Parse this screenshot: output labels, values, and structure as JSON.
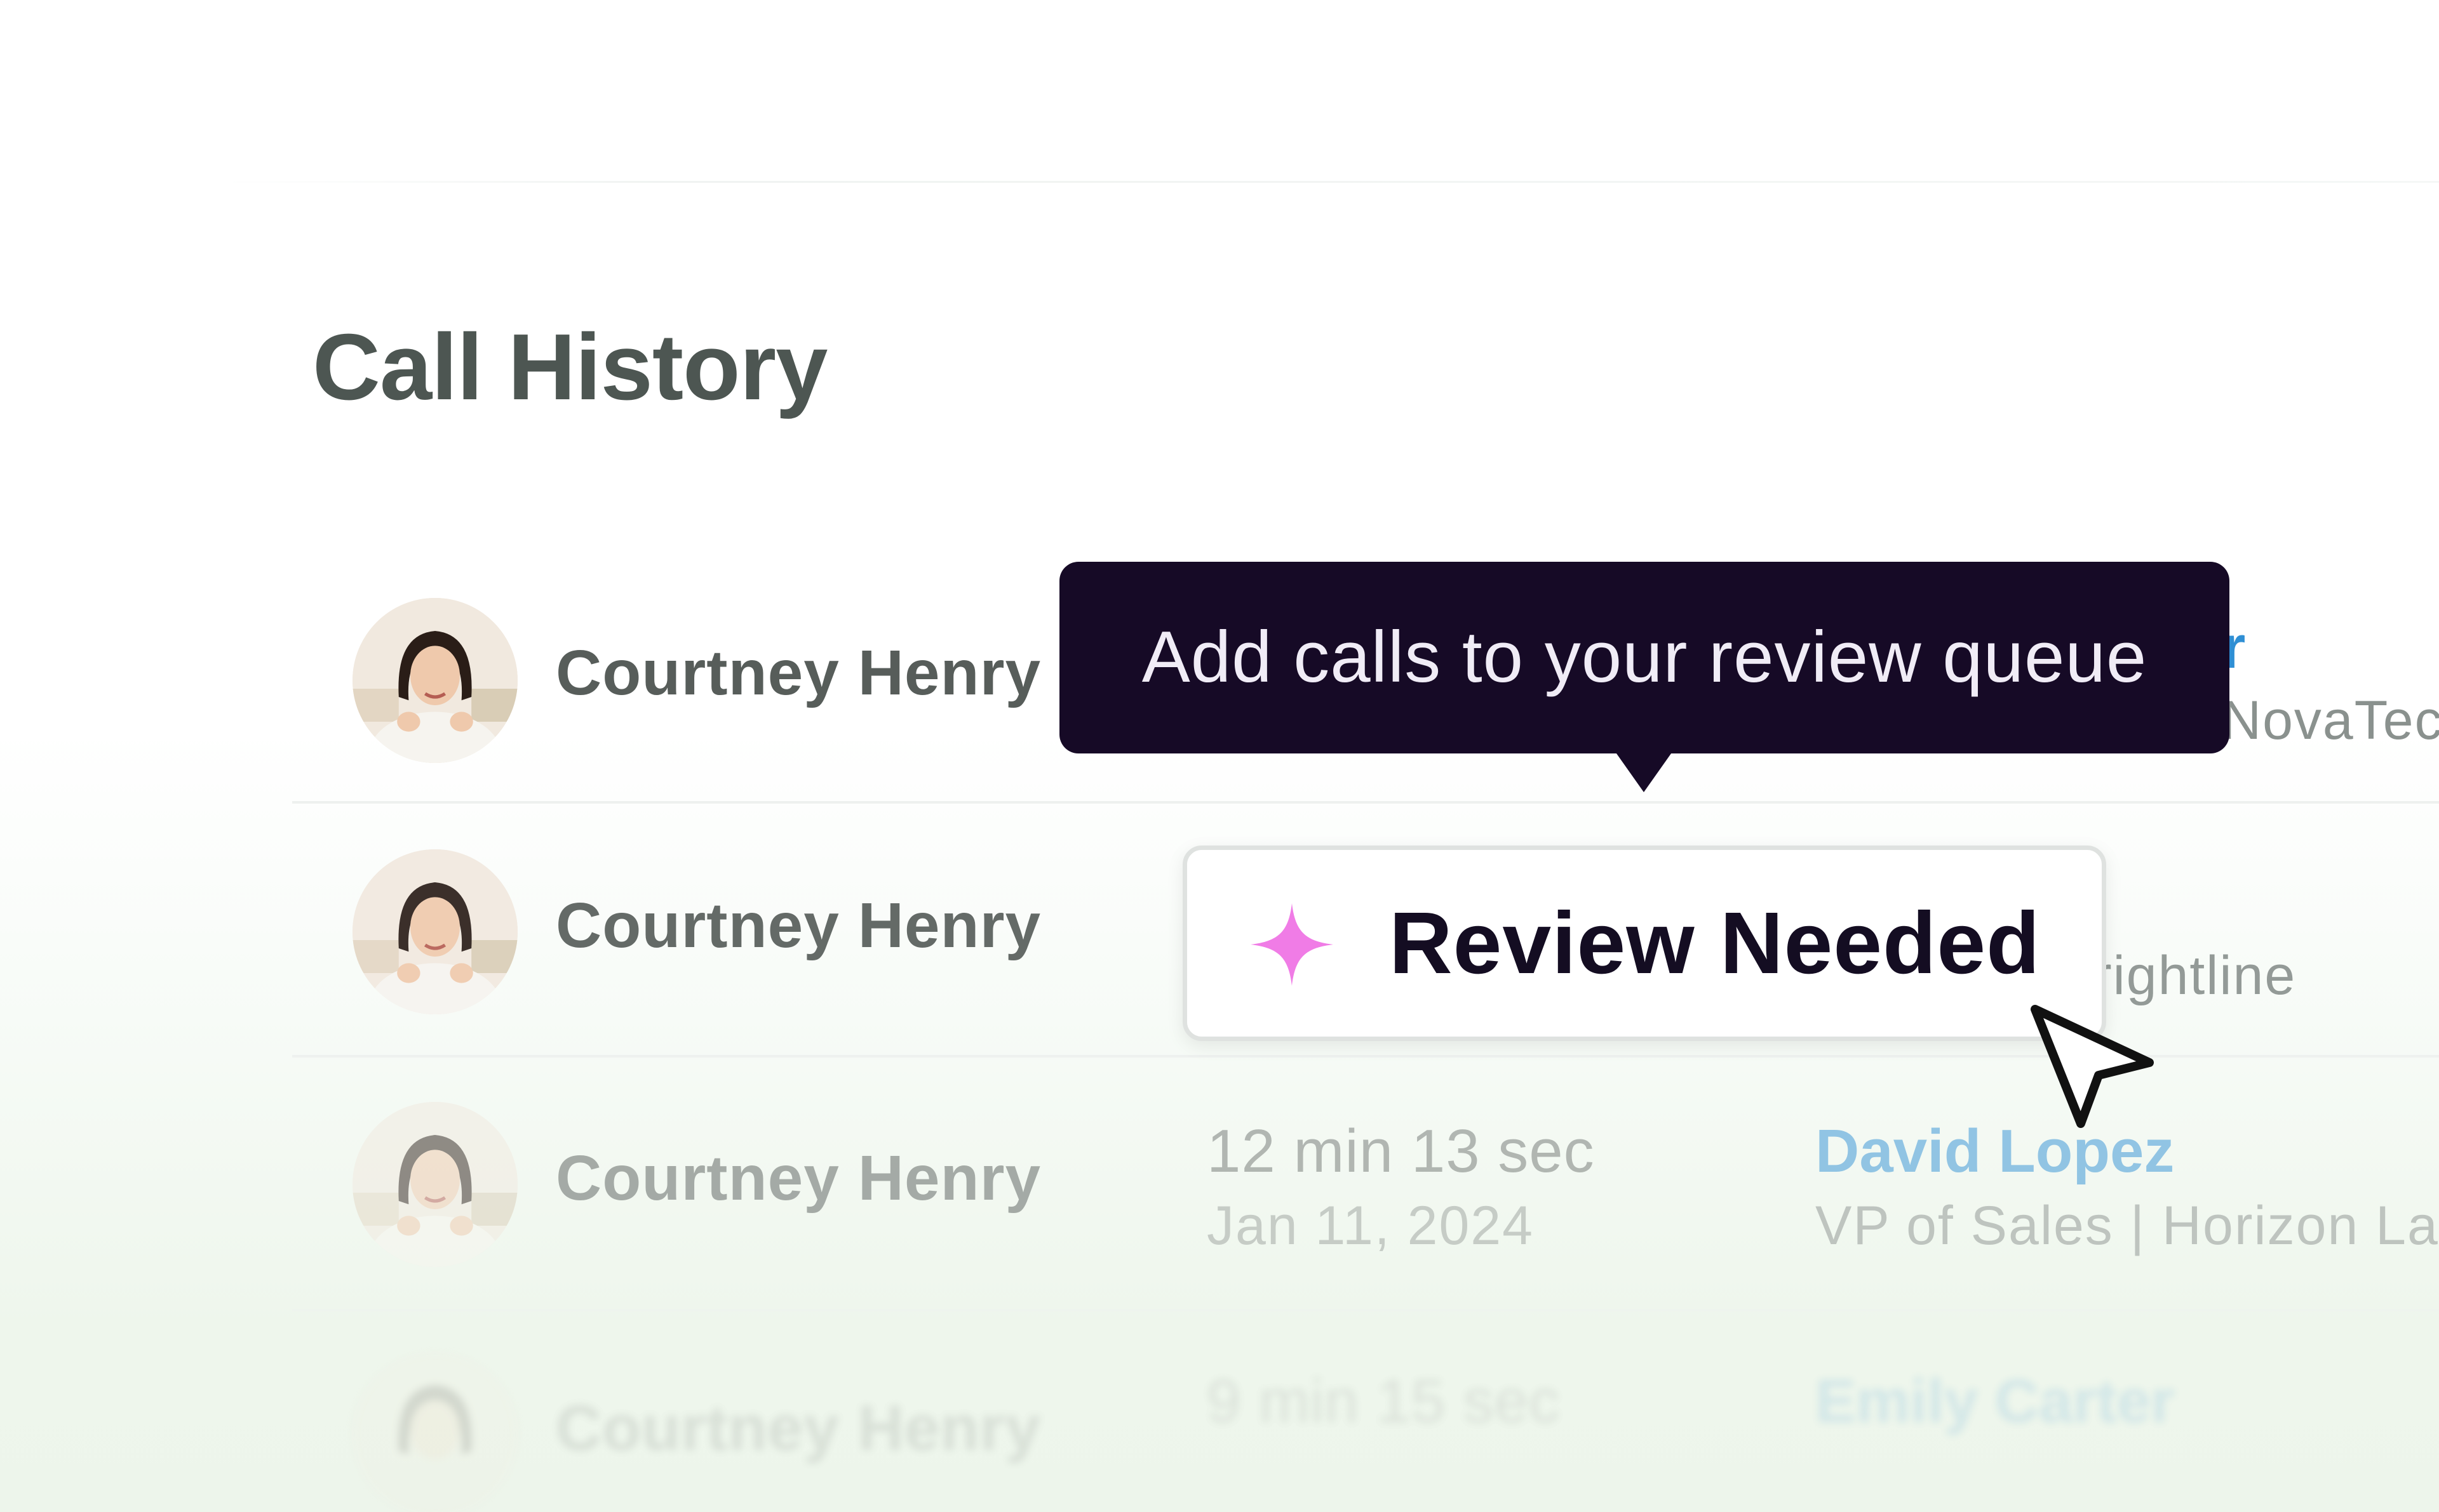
{
  "page": {
    "title": "Call History"
  },
  "tooltip": {
    "text": "Add calls to your review queue"
  },
  "review_button": {
    "label": "Review Needed",
    "icon": "sparkle-icon",
    "icon_color": "#f07ce6"
  },
  "rows": [
    {
      "name": "Courtney Henry",
      "duration": "",
      "date": "",
      "contact": "r",
      "contact_sub": "NovaTec"
    },
    {
      "name": "Courtney Henry",
      "duration": "",
      "date": "",
      "contact": "",
      "contact_sub": "rightline"
    },
    {
      "name": "Courtney Henry",
      "duration": "12 min 13 sec",
      "date": "Jan 11, 2024",
      "contact": "David Lopez",
      "contact_sub": "VP of Sales | Horizon Lal"
    },
    {
      "name": "Courtney Henry",
      "duration": "9 min 15 sec",
      "date": "",
      "contact": "Emily Carter",
      "contact_sub": ""
    }
  ],
  "colors": {
    "tooltip_bg": "#160a26",
    "contact_link": "#2f8fd4",
    "title": "#4d5652"
  }
}
